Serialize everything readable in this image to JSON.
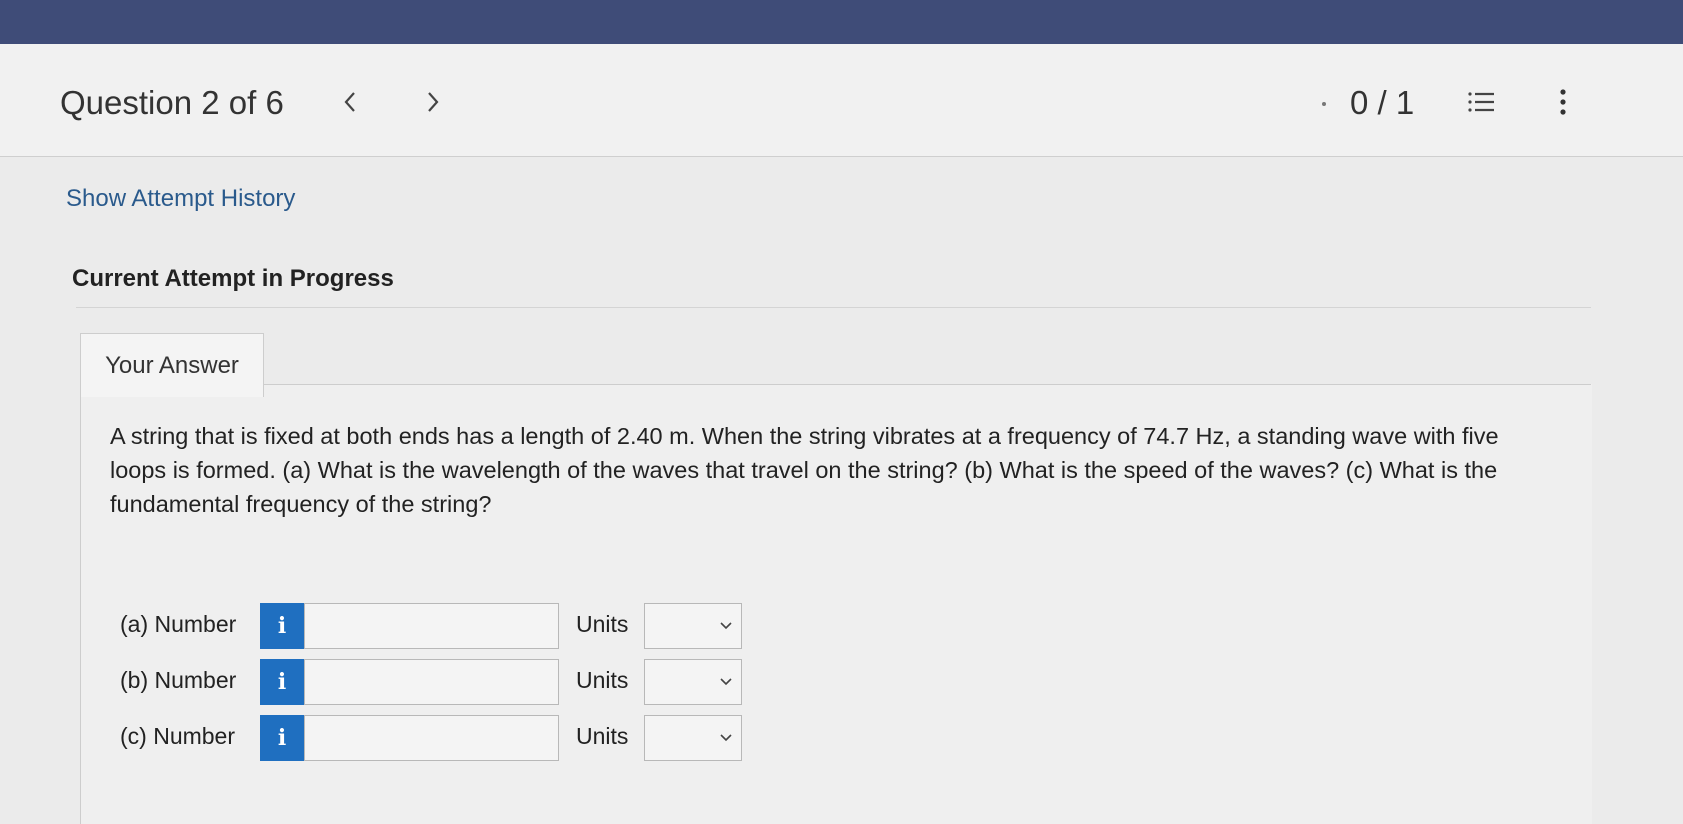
{
  "header": {
    "question_label": "Question 2 of 6",
    "score": "0 / 1"
  },
  "icons": {
    "prev": "chevron-left-icon",
    "next": "chevron-right-icon",
    "list": "list-icon",
    "more": "more-vertical-icon"
  },
  "attempt": {
    "history_link": "Show Attempt History",
    "current_heading": "Current Attempt in Progress"
  },
  "tab": {
    "label": "Your Answer"
  },
  "question": {
    "text": "A string that is fixed at both ends has a length of 2.40 m. When the string vibrates at a frequency of 74.7 Hz, a standing wave with five loops is formed. (a) What is the wavelength of the waves that travel on the string? (b) What is the speed of the waves? (c) What is the fundamental frequency of the string?"
  },
  "answers": [
    {
      "label": "(a) Number",
      "info": "i",
      "value": "",
      "units_label": "Units",
      "units_value": ""
    },
    {
      "label": "(b) Number",
      "info": "i",
      "value": "",
      "units_label": "Units",
      "units_value": ""
    },
    {
      "label": "(c) Number",
      "info": "i",
      "value": "",
      "units_label": "Units",
      "units_value": ""
    }
  ],
  "colors": {
    "topbar": "#3f4c78",
    "info_button": "#1f6fc0",
    "link": "#2a5a8c"
  }
}
